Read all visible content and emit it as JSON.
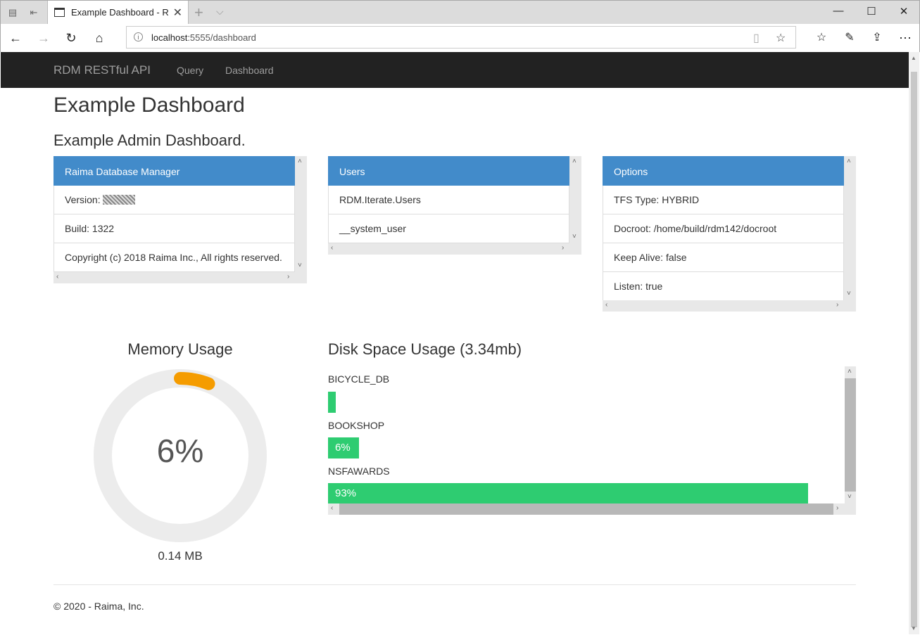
{
  "browser": {
    "tab_title": "Example Dashboard - R",
    "url_host": "localhost",
    "url_rest": ":5555/dashboard"
  },
  "site": {
    "brand": "RDM RESTful API",
    "nav": [
      {
        "label": "Query"
      },
      {
        "label": "Dashboard"
      }
    ]
  },
  "page": {
    "title": "Example Dashboard",
    "subtitle": "Example Admin Dashboard."
  },
  "panels": {
    "rdm": {
      "header": "Raima Database Manager",
      "items": [
        "Version: ",
        "Build: 1322",
        "Copyright (c) 2018 Raima Inc., All rights reserved."
      ]
    },
    "users": {
      "header": "Users",
      "items": [
        "RDM.Iterate.Users",
        "__system_user"
      ]
    },
    "options": {
      "header": "Options",
      "items": [
        "TFS Type: HYBRID",
        "Docroot: /home/build/rdm142/docroot",
        "Keep Alive: false",
        "Listen: true"
      ]
    }
  },
  "memory": {
    "title": "Memory Usage",
    "percent_label": "6%",
    "percent": 6,
    "value_label": "0.14 MB",
    "accent_color": "#f59c00"
  },
  "disk": {
    "title": "Disk Space Usage (3.34mb)",
    "bar_color": "#2ecc71",
    "databases": [
      {
        "name": "BICYCLE_DB",
        "label": "",
        "percent": 1
      },
      {
        "name": "BOOKSHOP",
        "label": "6%",
        "percent": 6
      },
      {
        "name": "NSFAWARDS",
        "label": "93%",
        "percent": 93
      }
    ]
  },
  "footer": {
    "text": "© 2020 - Raima, Inc."
  }
}
